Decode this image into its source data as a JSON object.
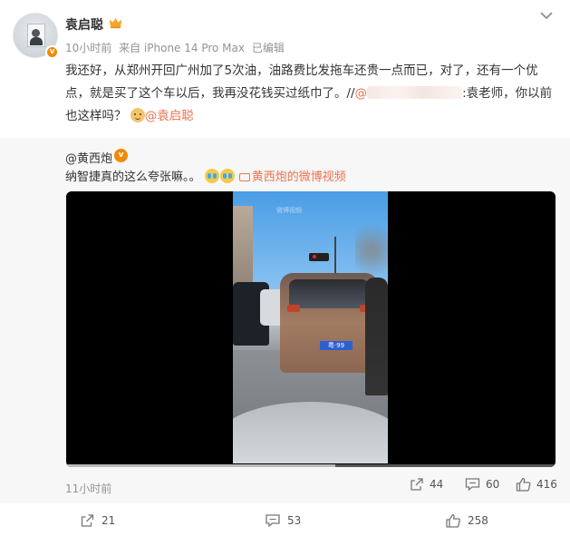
{
  "user": {
    "name": "袁启聪",
    "verified_mark": "v"
  },
  "meta": {
    "time": "10小时前",
    "source": "来自 iPhone 14 Pro Max",
    "edited": "已编辑"
  },
  "post": {
    "text_main": "我还好，从郑州开回广州加了5次油，油路费比发拖车还贵一点而已，对了，还有一个优点，就是买了这个车以后，我再没花钱买过纸巾了。//",
    "mention_prefix": "@",
    "mention_suffix": ":袁老师，你以前也这样吗？",
    "self_mention": "@袁启聪"
  },
  "repost": {
    "author": "@黄西炮",
    "verified_mark": "v",
    "text": "纳智捷真的这么夸张嘛。。",
    "video_link": "黄西炮的微博视频",
    "video_watermark": "微博视频",
    "plate": "粤·99",
    "progress": 0.55,
    "time": "11小时前",
    "reposts": "44",
    "comments": "60",
    "likes": "416"
  },
  "footer": {
    "reposts": "21",
    "comments": "53",
    "likes": "258"
  },
  "colors": {
    "link": "#eb7350",
    "badge": "#f08a00",
    "repost_bg": "#f7f7f7"
  }
}
